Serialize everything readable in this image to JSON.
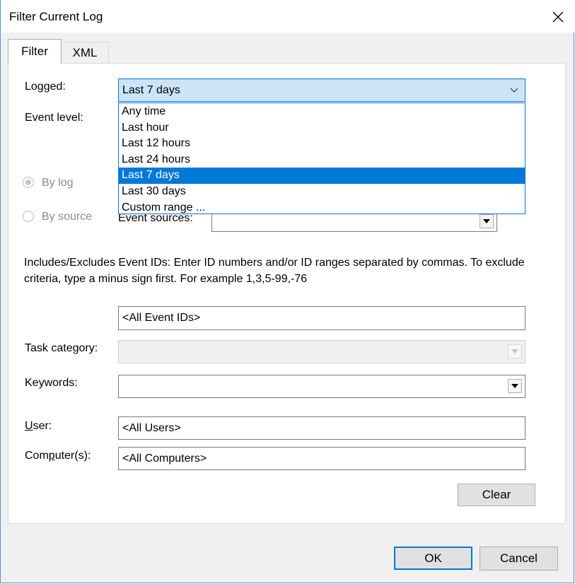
{
  "window": {
    "title": "Filter Current Log"
  },
  "tabs": [
    {
      "label": "Filter"
    },
    {
      "label": "XML"
    }
  ],
  "filter": {
    "logged_label": "Logged:",
    "logged_value": "Last 7 days",
    "logged_options": [
      "Any time",
      "Last hour",
      "Last 12 hours",
      "Last 24 hours",
      "Last 7 days",
      "Last 30 days",
      "Custom range ..."
    ],
    "event_level_label": "Event level:",
    "by_log_label": "By log",
    "by_source_label": "By source",
    "event_sources_label": "Event sources:",
    "event_sources_value": "",
    "event_ids_help": "Includes/Excludes Event IDs: Enter ID numbers and/or ID ranges separated by commas. To exclude criteria, type a minus sign first. For example 1,3,5-99,-76",
    "event_ids_value": "<All Event IDs>",
    "task_category_label": "Task category:",
    "task_category_value": "",
    "keywords_label": "Keywords:",
    "keywords_value": "",
    "user_label_u": "U",
    "user_label_rest": "ser:",
    "user_value": "<All Users>",
    "computers_label_pre": "Com",
    "computers_label_u": "p",
    "computers_label_rest": "uter(s):",
    "computers_value": "<All Computers>",
    "clear_label": "Clear"
  },
  "footer": {
    "ok_label": "OK",
    "cancel_label": "Cancel"
  },
  "colors": {
    "accent": "#0078d7",
    "selection_bg": "#cce4f7",
    "dialog_bg": "#f0f0f0"
  }
}
